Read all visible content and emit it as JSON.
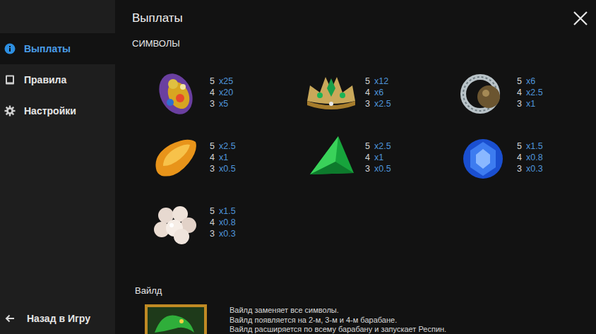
{
  "title": "Выплаты",
  "sidebar": {
    "items": [
      {
        "label": "Выплаты",
        "kind": "info",
        "selected": true
      },
      {
        "label": "Правила",
        "kind": "book",
        "selected": false
      },
      {
        "label": "Настройки",
        "kind": "gear",
        "selected": false
      }
    ],
    "back": {
      "label": "Назад в Игру"
    }
  },
  "section": "СИМВОЛЫ",
  "symbols": [
    {
      "kind": "brooch",
      "pays": [
        {
          "count": "5",
          "multiplier": "x25"
        },
        {
          "count": "4",
          "multiplier": "x20"
        },
        {
          "count": "3",
          "multiplier": "x5"
        }
      ]
    },
    {
      "kind": "crown",
      "pays": [
        {
          "count": "5",
          "multiplier": "x12"
        },
        {
          "count": "4",
          "multiplier": "x6"
        },
        {
          "count": "3",
          "multiplier": "x2.5"
        }
      ]
    },
    {
      "kind": "ring",
      "pays": [
        {
          "count": "5",
          "multiplier": "x6"
        },
        {
          "count": "4",
          "multiplier": "x2.5"
        },
        {
          "count": "3",
          "multiplier": "x1"
        }
      ]
    },
    {
      "kind": "amber",
      "pays": [
        {
          "count": "5",
          "multiplier": "x2.5"
        },
        {
          "count": "4",
          "multiplier": "x1"
        },
        {
          "count": "3",
          "multiplier": "x0.5"
        }
      ]
    },
    {
      "kind": "emerald",
      "pays": [
        {
          "count": "5",
          "multiplier": "x2.5"
        },
        {
          "count": "4",
          "multiplier": "x1"
        },
        {
          "count": "3",
          "multiplier": "x0.5"
        }
      ]
    },
    {
      "kind": "sapphire",
      "pays": [
        {
          "count": "5",
          "multiplier": "x1.5"
        },
        {
          "count": "4",
          "multiplier": "x0.8"
        },
        {
          "count": "3",
          "multiplier": "x0.3"
        }
      ]
    },
    {
      "kind": "pearls",
      "pays": [
        {
          "count": "5",
          "multiplier": "x1.5"
        },
        {
          "count": "4",
          "multiplier": "x0.8"
        },
        {
          "count": "3",
          "multiplier": "x0.3"
        }
      ]
    }
  ],
  "wild": {
    "title": "Вайлд",
    "description": [
      "Вайлд заменяет все символы.",
      "Вайлд появляется на 2-м, 3-м и 4-м барабане.",
      "Вайлд расширяется по всему барабану и запускает Респин."
    ]
  }
}
